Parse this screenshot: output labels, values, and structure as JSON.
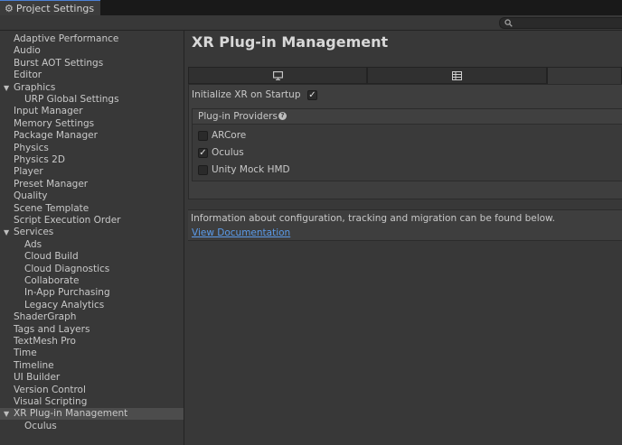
{
  "window": {
    "tab_title": "Project Settings",
    "tab_icon": "gear-icon"
  },
  "search": {
    "placeholder": "",
    "icon": "search-icon"
  },
  "sidebar": {
    "items": [
      {
        "label": "Adaptive Performance",
        "indent": 0
      },
      {
        "label": "Audio",
        "indent": 0
      },
      {
        "label": "Burst AOT Settings",
        "indent": 0
      },
      {
        "label": "Editor",
        "indent": 0
      },
      {
        "label": "Graphics",
        "indent": 0,
        "expanded": true
      },
      {
        "label": "URP Global Settings",
        "indent": 1
      },
      {
        "label": "Input Manager",
        "indent": 0
      },
      {
        "label": "Memory Settings",
        "indent": 0
      },
      {
        "label": "Package Manager",
        "indent": 0
      },
      {
        "label": "Physics",
        "indent": 0
      },
      {
        "label": "Physics 2D",
        "indent": 0
      },
      {
        "label": "Player",
        "indent": 0
      },
      {
        "label": "Preset Manager",
        "indent": 0
      },
      {
        "label": "Quality",
        "indent": 0
      },
      {
        "label": "Scene Template",
        "indent": 0
      },
      {
        "label": "Script Execution Order",
        "indent": 0
      },
      {
        "label": "Services",
        "indent": 0,
        "expanded": true
      },
      {
        "label": "Ads",
        "indent": 1
      },
      {
        "label": "Cloud Build",
        "indent": 1
      },
      {
        "label": "Cloud Diagnostics",
        "indent": 1
      },
      {
        "label": "Collaborate",
        "indent": 1
      },
      {
        "label": "In-App Purchasing",
        "indent": 1
      },
      {
        "label": "Legacy Analytics",
        "indent": 1
      },
      {
        "label": "ShaderGraph",
        "indent": 0
      },
      {
        "label": "Tags and Layers",
        "indent": 0
      },
      {
        "label": "TextMesh Pro",
        "indent": 0
      },
      {
        "label": "Time",
        "indent": 0
      },
      {
        "label": "Timeline",
        "indent": 0
      },
      {
        "label": "UI Builder",
        "indent": 0
      },
      {
        "label": "Version Control",
        "indent": 0
      },
      {
        "label": "Visual Scripting",
        "indent": 0
      },
      {
        "label": "XR Plug-in Management",
        "indent": 0,
        "expanded": true,
        "selected": true
      },
      {
        "label": "Oculus",
        "indent": 1
      }
    ]
  },
  "main": {
    "title": "XR Plug-in Management",
    "platform_tabs": [
      {
        "icon": "monitor-icon",
        "active": false
      },
      {
        "icon": "android-list-icon",
        "active": false
      },
      {
        "icon": "",
        "active": true
      }
    ],
    "initialize_label": "Initialize XR on Startup",
    "initialize_checked": true,
    "providers_header": "Plug-in Providers",
    "providers": [
      {
        "label": "ARCore",
        "checked": false
      },
      {
        "label": "Oculus",
        "checked": true
      },
      {
        "label": "Unity Mock HMD",
        "checked": false
      }
    ],
    "info_text": "Information about configuration, tracking and migration can be found below.",
    "doc_link": "View Documentation"
  },
  "colors": {
    "background": "#383838",
    "titlebar": "#191919",
    "accent": "#4a7fd6",
    "link": "#5b9bea"
  }
}
